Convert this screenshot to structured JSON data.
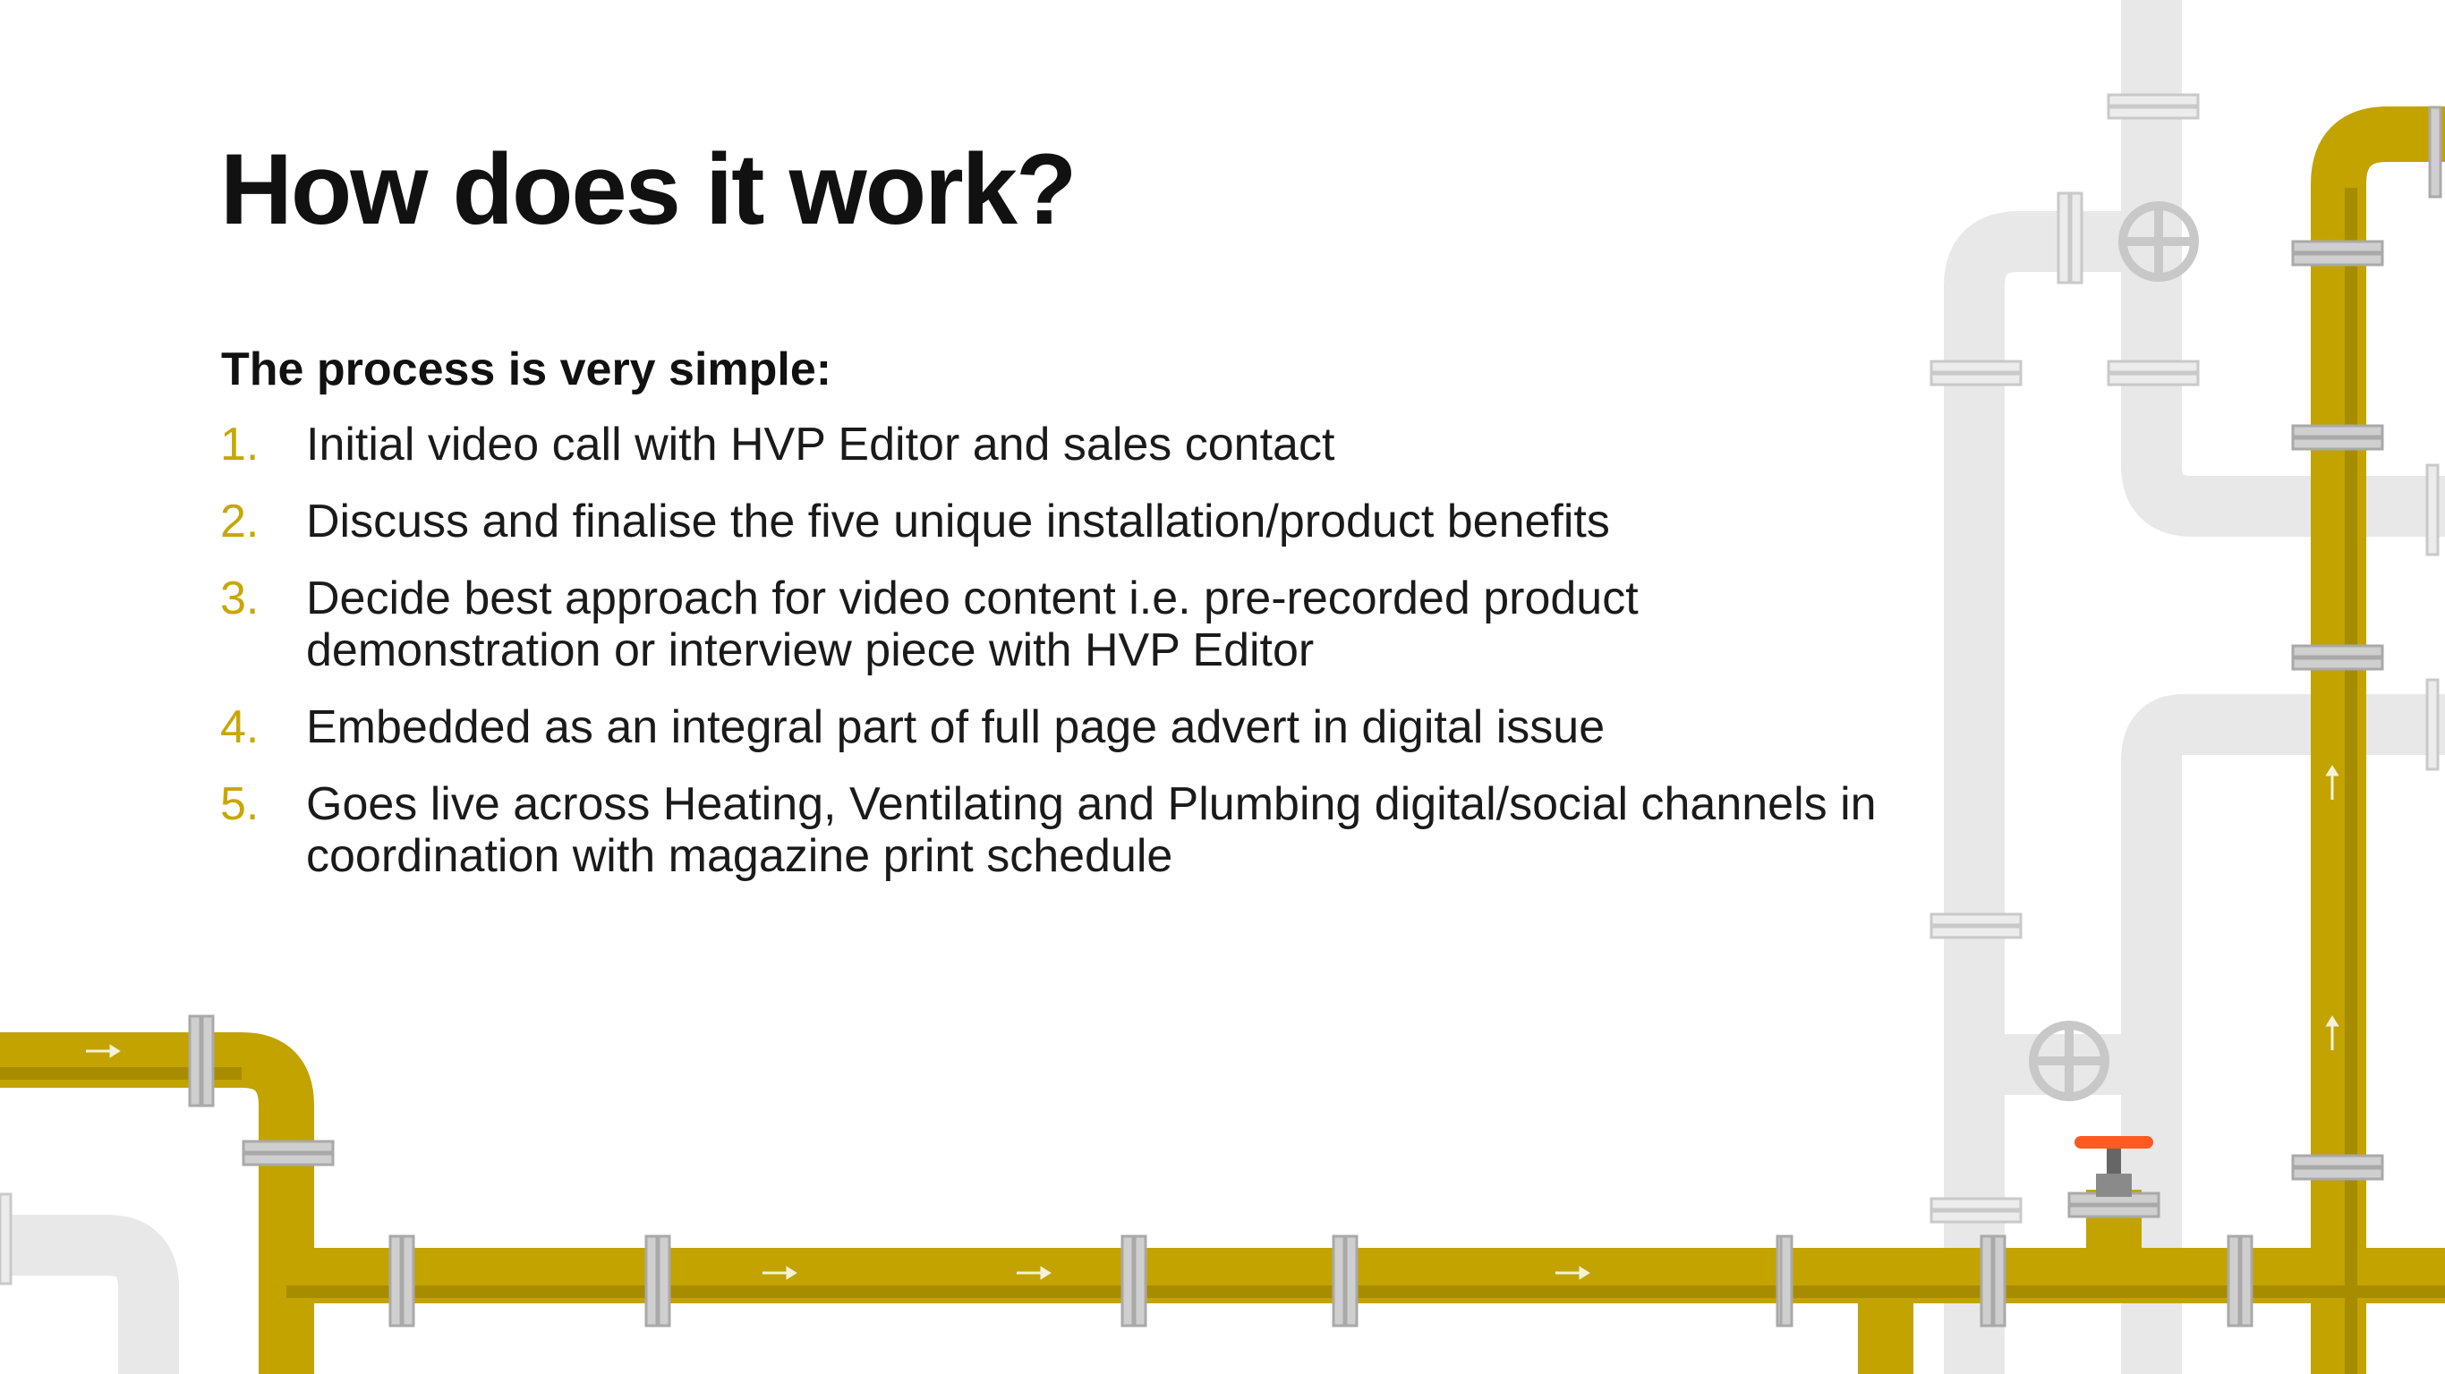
{
  "slide": {
    "title": "How does it work?",
    "intro": "The process is very simple:",
    "steps": [
      {
        "number": "1.",
        "text": "Initial video call with HVP Editor and sales contact"
      },
      {
        "number": "2.",
        "text": "Discuss and finalise the five unique installation/product benefits"
      },
      {
        "number": "3.",
        "text": "Decide best approach for video content i.e. pre-recorded product demonstration or interview piece with HVP Editor"
      },
      {
        "number": "4.",
        "text": "Embedded as an integral part of full page advert in digital issue"
      },
      {
        "number": "5.",
        "text": "Goes live across Heating, Ventilating and Plumbing digital/social channels in coordination with magazine print schedule"
      }
    ]
  },
  "colors": {
    "accent": "#c7a700",
    "pipe_yellow": "#c2a300",
    "pipe_grey": "#e8e8e8",
    "valve_handle": "#ff5a1f",
    "text": "#111111"
  },
  "decor": {
    "illustration": "pipes-illustration",
    "icons": [
      "valve-wheel-icon",
      "flow-arrow-icon",
      "pipe-flange-icon"
    ]
  }
}
